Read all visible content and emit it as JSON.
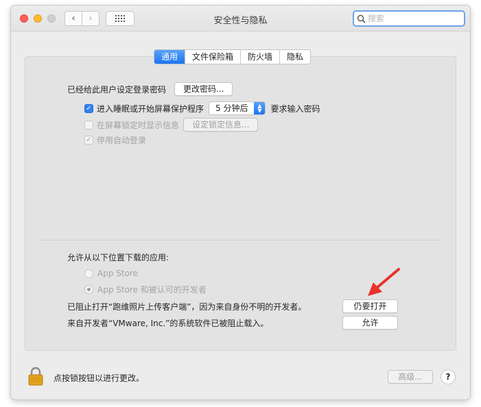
{
  "window": {
    "title": "安全性与隐私",
    "search_placeholder": "搜索"
  },
  "tabs": [
    {
      "label": "通用",
      "active": true
    },
    {
      "label": "文件保险箱",
      "active": false
    },
    {
      "label": "防火墙",
      "active": false
    },
    {
      "label": "隐私",
      "active": false
    }
  ],
  "general": {
    "password_label": "已经给此用户设定登录密码",
    "change_password_button": "更改密码...",
    "require_password": {
      "checked": true,
      "label_before": "进入睡眠或开始屏幕保护程序",
      "delay_value": "5 分钟后",
      "label_after": "要求输入密码"
    },
    "show_message": {
      "checked": false,
      "label": "在屏幕锁定时显示信息",
      "button": "设定锁定信息..."
    },
    "disable_autologin": {
      "checked": true,
      "label": "停用自动登录"
    }
  },
  "downloads": {
    "heading": "允许从以下位置下载的应用:",
    "options": [
      {
        "label": "App Store",
        "selected": false
      },
      {
        "label": "App Store 和被认可的开发者",
        "selected": true
      }
    ],
    "blocked_app_message": "已阻止打开“跑维照片上传客户端”，因为来自身份不明的开发者。",
    "open_anyway_button": "仍要打开",
    "blocked_software_message": "来自开发者“VMware, Inc.”的系统软件已被阻止载入。",
    "allow_button": "允许"
  },
  "footer": {
    "lock_text": "点按锁按钮以进行更改。",
    "advanced_button": "高级...",
    "help_button": "?"
  },
  "colors": {
    "accent": "#1c74f1",
    "annotation_arrow": "#e8332a"
  }
}
